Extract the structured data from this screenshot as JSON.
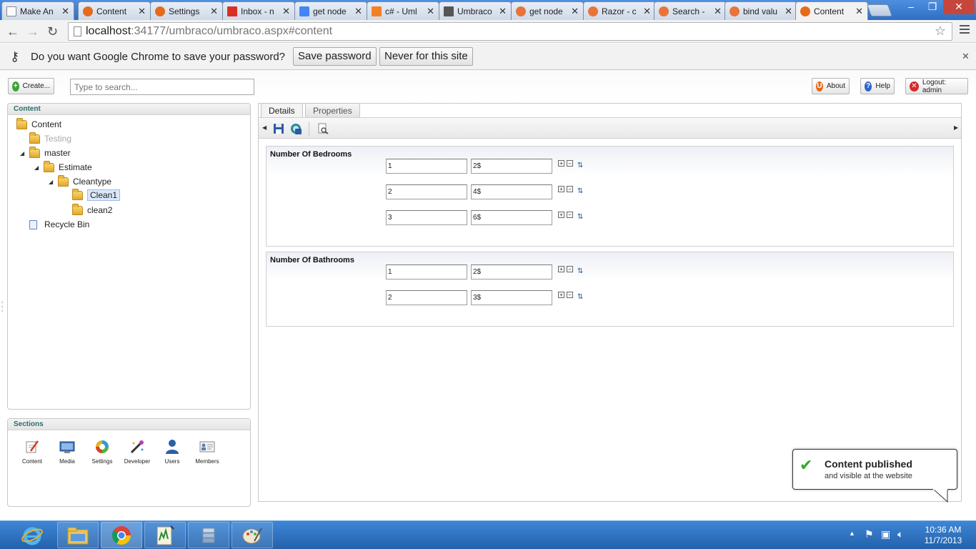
{
  "browser": {
    "tabs": [
      {
        "label": "Make An",
        "icon_color": "#ffffff"
      },
      {
        "label": "Content",
        "icon_color": "#e56a1c"
      },
      {
        "label": "Settings",
        "icon_color": "#e56a1c"
      },
      {
        "label": "Inbox - n",
        "icon_color": "#d93025"
      },
      {
        "label": "get node",
        "icon_color": "#4285f4"
      },
      {
        "label": "c# - Uml",
        "icon_color": "#f48024"
      },
      {
        "label": "Umbraco",
        "icon_color": "#555555"
      },
      {
        "label": "get node",
        "icon_color": "#e8743b"
      },
      {
        "label": "Razor - c",
        "icon_color": "#e8743b"
      },
      {
        "label": "Search - ",
        "icon_color": "#e8743b"
      },
      {
        "label": "bind valu",
        "icon_color": "#e8743b"
      },
      {
        "label": "Content",
        "icon_color": "#e56a1c",
        "active": true
      }
    ],
    "url_host": "localhost",
    "url_path": ":34177/umbraco/umbraco.aspx#content"
  },
  "infobar": {
    "message": "Do you want Google Chrome to save your password?",
    "save_label": "Save password",
    "never_label": "Never for this site"
  },
  "top": {
    "create_label": "Create...",
    "search_placeholder": "Type to search...",
    "about_label": "About",
    "help_label": "Help",
    "logout_label": "Logout: admin"
  },
  "tree": {
    "title": "Content",
    "nodes": [
      {
        "label": "Content"
      },
      {
        "label": "Testing"
      },
      {
        "label": "master"
      },
      {
        "label": "Estimate"
      },
      {
        "label": "Cleantype"
      },
      {
        "label": "Clean1"
      },
      {
        "label": "clean2"
      },
      {
        "label": "Recycle Bin"
      }
    ]
  },
  "sections": {
    "title": "Sections",
    "items": [
      {
        "label": "Content",
        "icon": "content-icon"
      },
      {
        "label": "Media",
        "icon": "media-icon"
      },
      {
        "label": "Settings",
        "icon": "settings-icon"
      },
      {
        "label": "Developer",
        "icon": "developer-icon"
      },
      {
        "label": "Users",
        "icon": "users-icon"
      },
      {
        "label": "Members",
        "icon": "members-icon"
      }
    ]
  },
  "editor": {
    "tabs": [
      {
        "label": "Details",
        "active": true
      },
      {
        "label": "Properties"
      }
    ],
    "properties": [
      {
        "name": "Number Of Bedrooms",
        "rows": [
          {
            "key": "1",
            "value": "2$"
          },
          {
            "key": "2",
            "value": "4$"
          },
          {
            "key": "3",
            "value": "6$"
          }
        ]
      },
      {
        "name": "Number Of Bathrooms",
        "rows": [
          {
            "key": "1",
            "value": "2$"
          },
          {
            "key": "2",
            "value": "3$"
          }
        ]
      }
    ]
  },
  "toast": {
    "title": "Content published",
    "subtitle": "and visible at the website"
  },
  "taskbar": {
    "time": "10:36 AM",
    "date": "11/7/2013"
  }
}
